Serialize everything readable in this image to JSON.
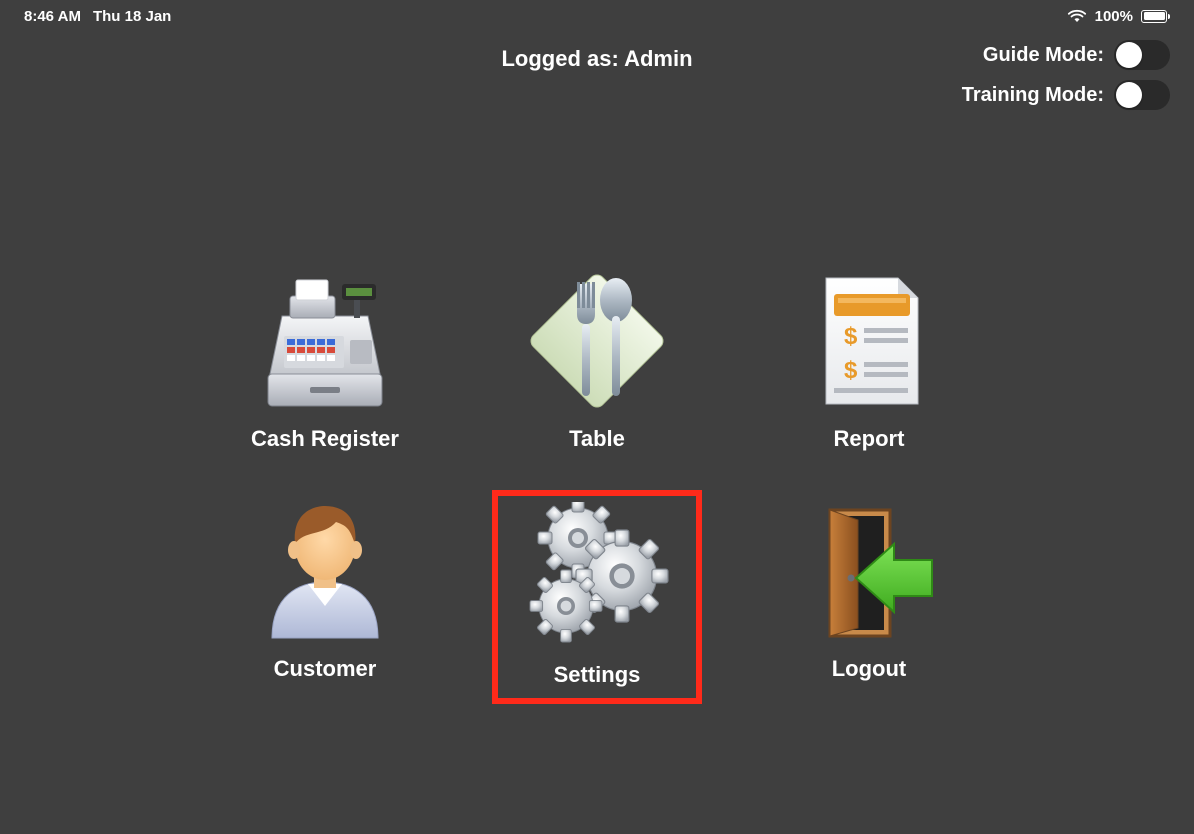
{
  "status_bar": {
    "time": "8:46 AM",
    "date": "Thu 18 Jan",
    "battery_pct": "100%"
  },
  "header": {
    "logged_as_label": "Logged as:",
    "logged_as_value": "Admin",
    "guide_mode_label": "Guide Mode:",
    "training_mode_label": "Training Mode:"
  },
  "menu": {
    "cash_register": "Cash Register",
    "table": "Table",
    "report": "Report",
    "customer": "Customer",
    "settings": "Settings",
    "logout": "Logout"
  }
}
